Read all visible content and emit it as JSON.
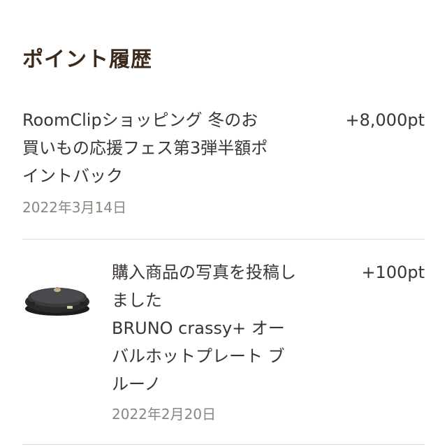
{
  "page": {
    "title": "ポイント履歴"
  },
  "history": [
    {
      "description": "RoomClipショッピング 冬のお\n買いもの応援フェス第3弾半額ポ\nイントバック",
      "points": "+8,000pt",
      "date": "2022年3月14日"
    },
    {
      "description": "購入商品の写真を投稿し\nました\nBRUNO crassy+ オー\nバルホットプレート ブ\nルーノ",
      "points": "+100pt",
      "date": "2022年2月20日",
      "image": "oval-hot-plate-product-photo"
    }
  ]
}
